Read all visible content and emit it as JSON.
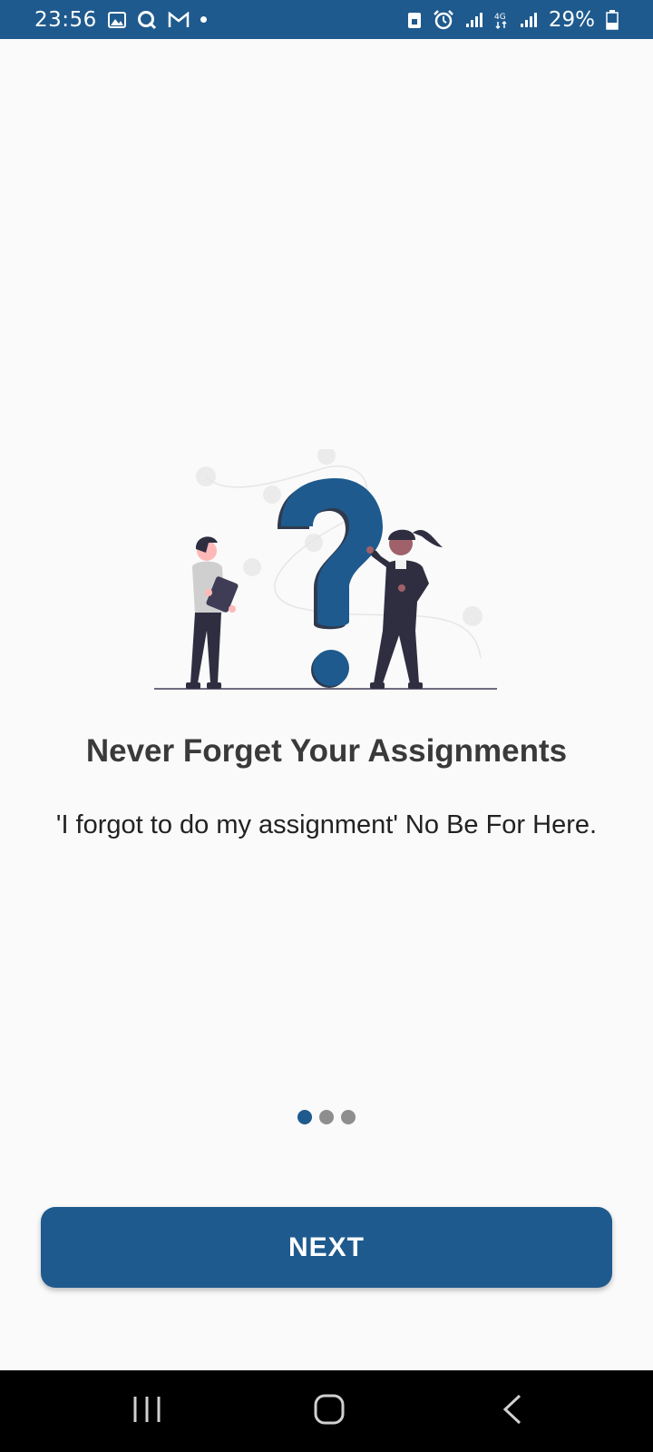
{
  "status_bar": {
    "time": "23:56",
    "battery": "29%",
    "left_icons": [
      "gallery-icon",
      "q-app-icon",
      "gmail-icon",
      "notification-dot-icon"
    ],
    "right_icons": [
      "lock-icon",
      "alarm-icon",
      "signal-icon",
      "4g-icon",
      "signal-icon",
      "battery-icon"
    ],
    "background": "#1e5a8e"
  },
  "onboarding": {
    "illustration": "question-mark-people-illustration",
    "title": "Never Forget Your Assignments",
    "subtitle": "'I forgot to do my assignment' No Be For Here.",
    "pages": 3,
    "active_page": 1,
    "next_label": "NEXT"
  },
  "nav_bar": {
    "buttons": [
      "recents-icon",
      "home-icon",
      "back-icon"
    ]
  },
  "colors": {
    "accent": "#1e5a8e",
    "title_text": "#3a3a3a",
    "inactive_dot": "#8e8e8e",
    "background": "#fafafa"
  }
}
